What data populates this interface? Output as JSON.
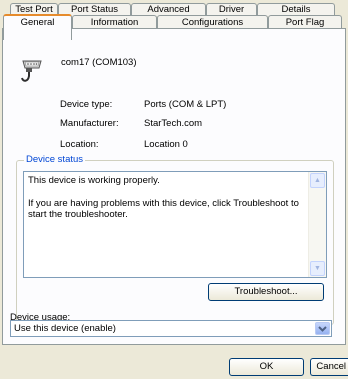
{
  "tabs_row1": [
    {
      "label": "Test Port"
    },
    {
      "label": "Port Status"
    },
    {
      "label": "Advanced"
    },
    {
      "label": "Driver"
    },
    {
      "label": "Details"
    }
  ],
  "tabs_row2": [
    {
      "label": "General",
      "active": true
    },
    {
      "label": "Information"
    },
    {
      "label": "Configurations"
    },
    {
      "label": "Port Flag"
    }
  ],
  "device": {
    "name": "com17 (COM103)",
    "icon": "serial-port-icon",
    "type_label": "Device type:",
    "type_value": "Ports (COM & LPT)",
    "manufacturer_label": "Manufacturer:",
    "manufacturer_value": "StarTech.com",
    "location_label": "Location:",
    "location_value": "Location 0"
  },
  "status": {
    "title": "Device status",
    "line1": "This device is working properly.",
    "line2": "If you are having problems with this device, click Troubleshoot to start the troubleshooter.",
    "troubleshoot_label": "Troubleshoot..."
  },
  "usage": {
    "label": "Device usage:",
    "selected": "Use this device (enable)"
  },
  "buttons": {
    "ok": "OK",
    "cancel": "Cancel"
  },
  "colors": {
    "window_bg": "#ece9d8",
    "tab_highlight": "#e68b2c",
    "group_title": "#0046d5"
  }
}
